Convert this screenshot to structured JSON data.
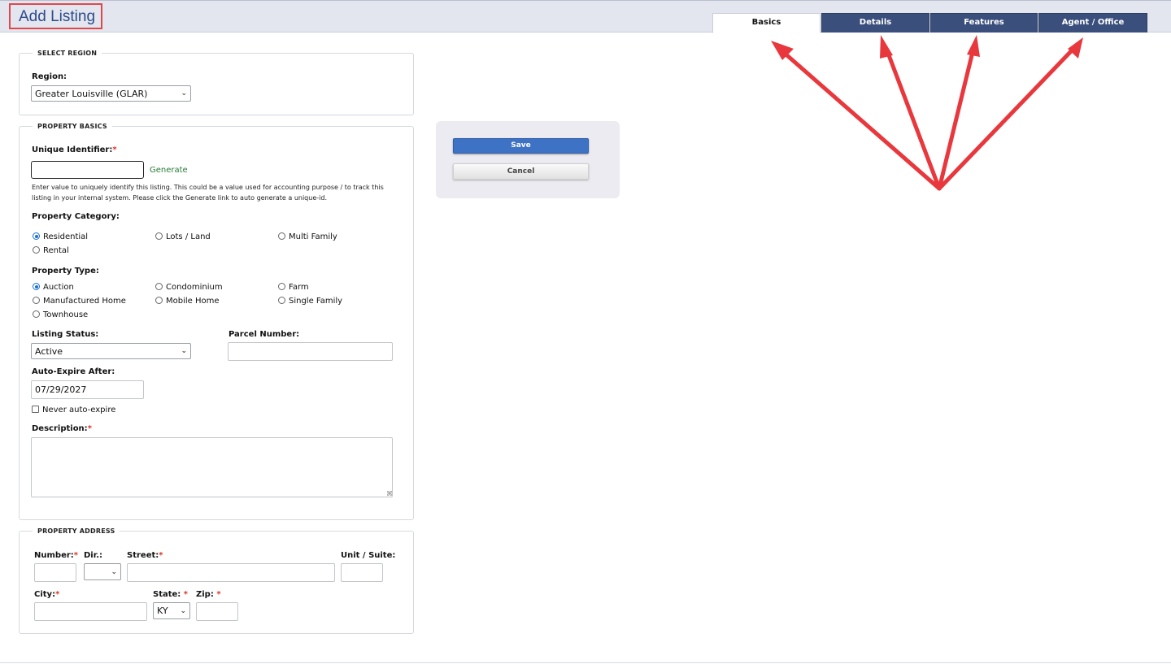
{
  "page": {
    "title": "Add Listing"
  },
  "tabs": [
    {
      "label": "Basics",
      "active": true
    },
    {
      "label": "Details",
      "active": false
    },
    {
      "label": "Features",
      "active": false
    },
    {
      "label": "Agent / Office",
      "active": false
    }
  ],
  "select_region": {
    "legend": "SELECT REGION",
    "region_label": "Region:",
    "region_value": "Greater Louisville (GLAR)"
  },
  "property_basics": {
    "legend": "PROPERTY BASICS",
    "unique_id_label": "Unique Identifier:",
    "required_mark": "*",
    "unique_id_value": "",
    "generate_link": "Generate",
    "help_line1": "Enter value to uniquely identify this listing. This could be a value used for accounting purpose / to track this",
    "help_line2": "listing in your internal system. Please click the Generate link to auto generate a unique-id.",
    "category_label": "Property Category:",
    "categories": [
      {
        "label": "Residential",
        "checked": true
      },
      {
        "label": "Lots / Land",
        "checked": false
      },
      {
        "label": "Multi Family",
        "checked": false
      },
      {
        "label": "Rental",
        "checked": false
      }
    ],
    "type_label": "Property Type:",
    "types": [
      {
        "label": "Auction",
        "checked": true
      },
      {
        "label": "Condominium",
        "checked": false
      },
      {
        "label": "Farm",
        "checked": false
      },
      {
        "label": "Manufactured Home",
        "checked": false
      },
      {
        "label": "Mobile Home",
        "checked": false
      },
      {
        "label": "Single Family",
        "checked": false
      },
      {
        "label": "Townhouse",
        "checked": false
      }
    ],
    "status_label": "Listing Status:",
    "status_value": "Active",
    "parcel_label": "Parcel Number:",
    "parcel_value": "",
    "expire_label": "Auto-Expire After:",
    "expire_value": "07/29/2027",
    "never_expire_label": "Never auto-expire",
    "never_expire_checked": false,
    "description_label": "Description:",
    "description_value": ""
  },
  "actions": {
    "save_label": "Save",
    "cancel_label": "Cancel"
  },
  "property_address": {
    "legend": "PROPERTY ADDRESS",
    "number_label": "Number:",
    "dir_label": "Dir.:",
    "dir_value": "",
    "street_label": "Street:",
    "unit_label": "Unit / Suite:",
    "city_label": "City:",
    "state_label": "State:",
    "state_value": "KY",
    "zip_label": "Zip:"
  },
  "colors": {
    "tab_inactive": "#3b4f7c",
    "annotation_red": "#e8383d",
    "save_blue": "#3e72c4",
    "title_blue": "#2d4b8a"
  }
}
